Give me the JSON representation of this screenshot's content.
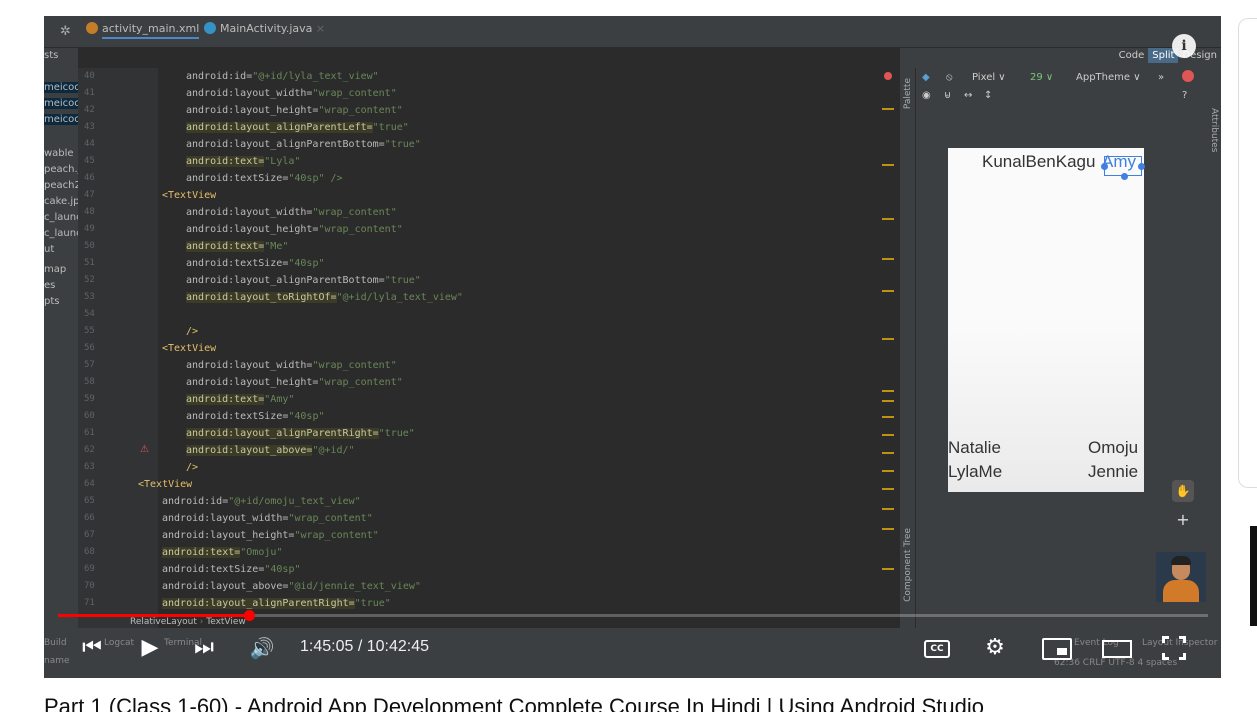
{
  "tabs": [
    {
      "label": "activity_main.xml",
      "close": "×"
    },
    {
      "label": "MainActivity.java",
      "close": "×"
    }
  ],
  "sidebar": [
    "sts",
    "meicoc",
    "meicoc",
    "meicoc",
    "wable",
    "peach.j",
    "peach2.",
    "cake.jpg",
    "c_launc",
    "c_launc",
    "ut",
    "map",
    "es",
    "pts"
  ],
  "lines": [
    40,
    41,
    42,
    43,
    44,
    45,
    46,
    47,
    48,
    49,
    50,
    51,
    52,
    53,
    54,
    55,
    56,
    57,
    58,
    59,
    60,
    61,
    62,
    63,
    64,
    65,
    66,
    67,
    68,
    69,
    70,
    71
  ],
  "code": [
    "android:id=\"@+id/lyla_text_view\"",
    "android:layout_width=\"wrap_content\"",
    "android:layout_height=\"wrap_content\"",
    "android:layout_alignParentLeft=\"true\"",
    "android:layout_alignParentBottom=\"true\"",
    "android:text=\"Lyla\"",
    "android:textSize=\"40sp\" />",
    "<TextView",
    "android:layout_width=\"wrap_content\"",
    "android:layout_height=\"wrap_content\"",
    "android:text=\"Me\"",
    "android:textSize=\"40sp\"",
    "android:layout_alignParentBottom=\"true\"",
    "android:layout_toRightOf=\"@+id/lyla_text_view\"",
    "",
    "/>",
    "<TextView",
    "android:layout_width=\"wrap_content\"",
    "android:layout_height=\"wrap_content\"",
    "android:text=\"Amy\"",
    "android:textSize=\"40sp\"",
    "android:layout_alignParentRight=\"true\"",
    "android:layout_above=\"@+id/\"",
    "/>",
    "<TextView",
    "android:id=\"@+id/omoju_text_view\"",
    "android:layout_width=\"wrap_content\"",
    "android:layout_height=\"wrap_content\"",
    "android:text=\"Omoju\"",
    "android:textSize=\"40sp\"",
    "android:layout_above=\"@id/jennie_text_view\"",
    "android:layout_alignParentRight=\"true\""
  ],
  "design": {
    "modes": {
      "code": "Code",
      "split": "Split",
      "design": "Design"
    },
    "toolbar": {
      "device": "Pixel ∨",
      "api": "29 ∨",
      "theme": "AppTheme ∨"
    },
    "palette": "Palette",
    "component_tree": "Component Tree",
    "attributes": "Attributes",
    "preview": {
      "top": "KunalBenKagu",
      "top_overlap": "Amy",
      "natalie": "Natalie",
      "omoju": "Omoju",
      "lylame": "LylaMe",
      "jennie": "Jennie"
    }
  },
  "breadcrumb": {
    "a": "RelativeLayout",
    "b": "TextView"
  },
  "status_left": [
    "Build",
    "name"
  ],
  "status_ghost": {
    "logcat": "Logcat",
    "terminal": "Terminal",
    "event": "Event Log",
    "layout": "Layout Inspector",
    "pos": "62:36  CRLF  UTF-8  4 spaces"
  },
  "player": {
    "current_time": "1:45:05",
    "duration": "10:42:45",
    "time_display": "1:45:05 / 10:42:45",
    "progress": 0.166,
    "cc": "CC"
  },
  "video_title": "Part 1 (Class 1-60) - Android App Development Complete Course In Hindi | Using Android Studio"
}
